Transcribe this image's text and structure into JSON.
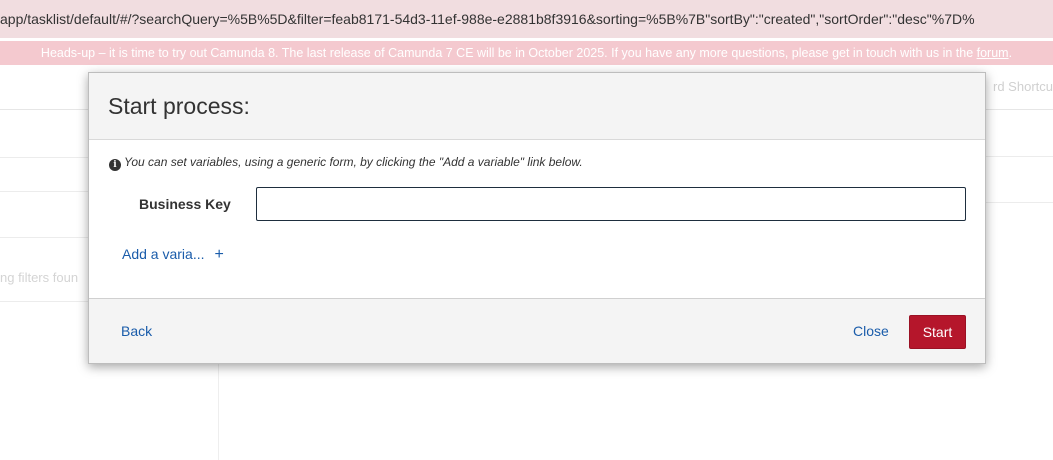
{
  "browser": {
    "url_text": "app/tasklist/default/#/?searchQuery=%5B%5D&filter=feab8171-54d3-11ef-988e-e2881b8f3916&sorting=%5B%7B\"sortBy\":\"created\",\"sortOrder\":\"desc\"%7D%"
  },
  "notice": {
    "text": "Heads-up – it is time to try out Camunda 8. The last release of Camunda 7 CE will be in October 2025. If you have any more questions, please get in touch with us in the ",
    "link_label": "forum",
    "suffix": "."
  },
  "background": {
    "shortcut_text": "rd Shortcu",
    "filters_text": "ng filters foun"
  },
  "modal": {
    "title": "Start process:",
    "info_text": "You can set variables, using a generic form, by clicking the \"Add a variable\" link below.",
    "business_key_label": "Business Key",
    "business_key_value": "",
    "add_variable_label": "Add a varia...",
    "add_variable_icon": "plus-icon",
    "back_label": "Back",
    "close_label": "Close",
    "start_label": "Start"
  },
  "colors": {
    "accent": "#b5162b",
    "link": "#1a5caa",
    "notice_bg": "#f4c9cf"
  }
}
